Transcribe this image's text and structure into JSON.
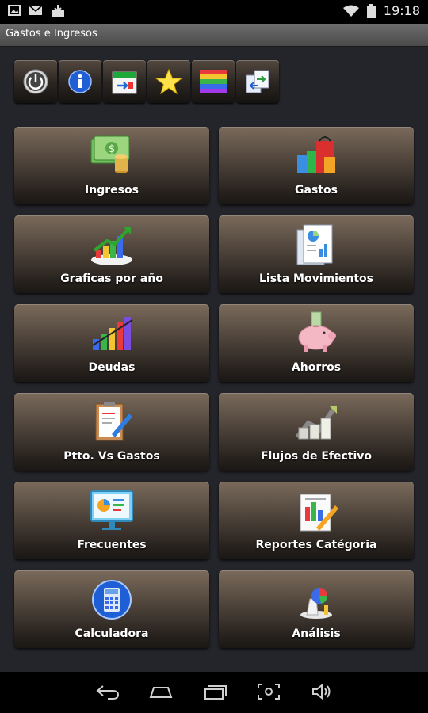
{
  "status_bar": {
    "time": "19:18",
    "left_icons": [
      "image-icon",
      "mail-icon",
      "download-icon"
    ],
    "right_icons": [
      "wifi-icon",
      "battery-icon"
    ]
  },
  "app": {
    "title": "Gastos e Ingresos"
  },
  "toolbar": {
    "buttons": [
      "power-icon",
      "info-icon",
      "calendar-transfer-icon",
      "star-icon",
      "color-bars-icon",
      "backup-icon"
    ]
  },
  "menu": {
    "items": [
      {
        "label": "Ingresos",
        "icon": "money-icon"
      },
      {
        "label": "Gastos",
        "icon": "shopping-bags-icon"
      },
      {
        "label": "Graficas por año",
        "icon": "growth-chart-icon"
      },
      {
        "label": "Lista Movimientos",
        "icon": "documents-icon"
      },
      {
        "label": "Deudas",
        "icon": "declining-chart-icon"
      },
      {
        "label": "Ahorros",
        "icon": "piggy-bank-icon"
      },
      {
        "label": "Ptto. Vs Gastos",
        "icon": "clipboard-pen-icon"
      },
      {
        "label": "Flujos de Efectivo",
        "icon": "cash-flow-icon"
      },
      {
        "label": "Frecuentes",
        "icon": "presentation-icon"
      },
      {
        "label": "Reportes Catégoria",
        "icon": "report-chart-icon"
      },
      {
        "label": "Calculadora",
        "icon": "calculator-icon"
      },
      {
        "label": "Análisis",
        "icon": "analysis-icon"
      }
    ]
  },
  "nav_bar": {
    "buttons": [
      "back-icon",
      "home-icon",
      "recents-icon",
      "screenshot-icon",
      "volume-icon"
    ]
  }
}
